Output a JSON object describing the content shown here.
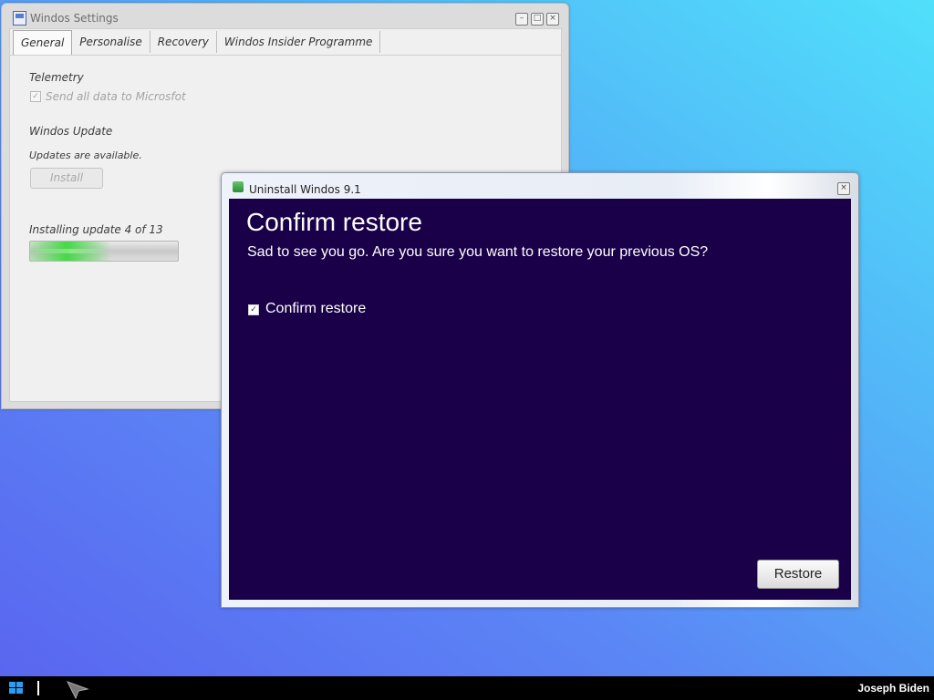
{
  "settings_window": {
    "title": "Windos Settings",
    "tabs": [
      {
        "label": "General",
        "active": true
      },
      {
        "label": "Personalise",
        "active": false
      },
      {
        "label": "Recovery",
        "active": false
      },
      {
        "label": "Windos Insider Programme",
        "active": false
      }
    ],
    "telemetry": {
      "heading": "Telemetry",
      "checkbox_label": "Send all data to Microsfot",
      "checked": true
    },
    "update": {
      "heading": "Windos Update",
      "status": "Updates are available.",
      "install_label": "Install"
    },
    "progress": {
      "label": "Installing update 4 of 13",
      "current": 4,
      "total": 13,
      "fraction": 0.55
    }
  },
  "uninstall_dialog": {
    "title": "Uninstall Windos 9.1",
    "heading": "Confirm restore",
    "subtitle": "Sad to see you go. Are you sure you want to restore your previous OS?",
    "checkbox_label": "Confirm restore",
    "checked": true,
    "restore_label": "Restore",
    "background_color": "#1a0048"
  },
  "taskbar": {
    "user": "Joseph Biden",
    "icons": [
      "windows-logo-icon",
      "cursor-icon"
    ]
  }
}
